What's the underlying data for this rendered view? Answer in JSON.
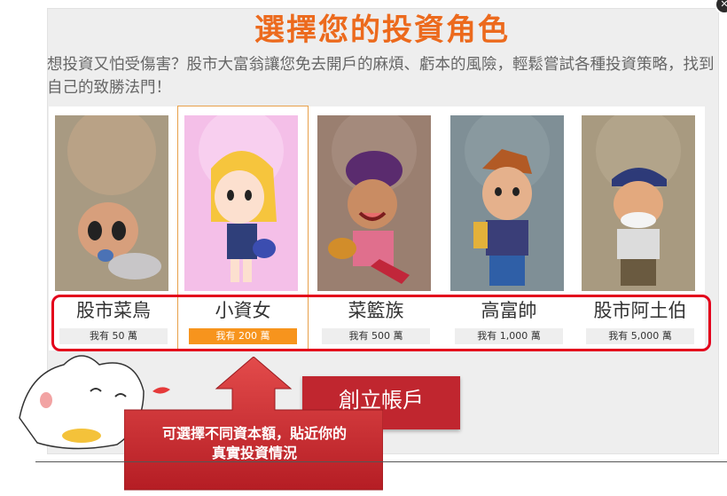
{
  "dialog": {
    "title": "選擇您的投資角色",
    "description": "想投資又怕受傷害？股市大富翁讓您免去開戶的麻煩、虧本的風險，輕鬆嘗試各種投資策略，找到自己的致勝法門！"
  },
  "roles": [
    {
      "name": "股市菜鳥",
      "amount": "我有 50 萬",
      "selected": false
    },
    {
      "name": "小資女",
      "amount": "我有 200 萬",
      "selected": true
    },
    {
      "name": "菜籃族",
      "amount": "我有 500 萬",
      "selected": false
    },
    {
      "name": "高富帥",
      "amount": "我有 1,000 萬",
      "selected": false
    },
    {
      "name": "股市阿土伯",
      "amount": "我有 5,000 萬",
      "selected": false
    }
  ],
  "create_button": {
    "label": "創立帳戶"
  },
  "callout": {
    "text_line1": "可選擇不同資本額，貼近你的",
    "text_line2": "真實投資情況"
  },
  "colors": {
    "title": "#ec6a1d",
    "selected_amount": "#f7941d",
    "highlight": "#e3001b",
    "button": "#c0262f"
  }
}
